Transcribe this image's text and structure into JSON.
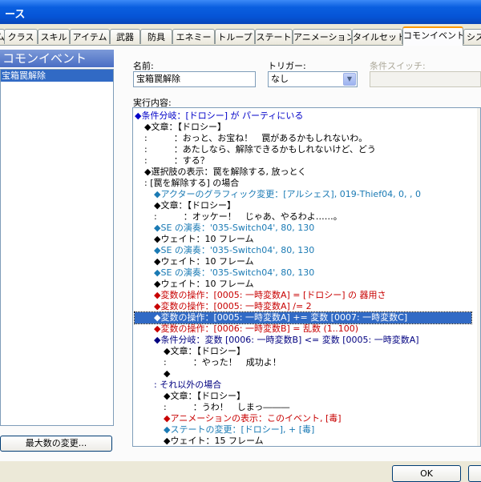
{
  "window": {
    "title": "ース"
  },
  "tabs": [
    {
      "label": "ム"
    },
    {
      "label": "クラス"
    },
    {
      "label": "スキル"
    },
    {
      "label": "アイテム"
    },
    {
      "label": "武器"
    },
    {
      "label": "防具"
    },
    {
      "label": "エネミー"
    },
    {
      "label": "トループ"
    },
    {
      "label": "ステート"
    },
    {
      "label": "アニメーション"
    },
    {
      "label": "タイルセット"
    },
    {
      "label": "コモンイベント"
    },
    {
      "label": "シス"
    }
  ],
  "left": {
    "header": "コモンイベント",
    "items": [
      {
        "label": "宝箱罠解除"
      }
    ],
    "max_button": "最大数の変更..."
  },
  "form": {
    "name_label": "名前:",
    "name_value": "宝箱罠解除",
    "trigger_label": "トリガー:",
    "trigger_value": "なし",
    "switch_label": "条件スイッチ:",
    "contents_label": "実行内容:"
  },
  "events": [
    {
      "text": "◆条件分岐：[ドロシー] が パーティにいる",
      "color": "c-blue",
      "indent": 0
    },
    {
      "text": "◆文章：【ドロシー】",
      "color": "c-black",
      "indent": 1
    },
    {
      "text": ":　　　：おっと、お宝ね！　罠があるかもしれないわ。",
      "color": "c-black",
      "indent": 1
    },
    {
      "text": ":　　　：あたしなら、解除できるかもしれないけど、どう",
      "color": "c-black",
      "indent": 1
    },
    {
      "text": ":　　　：する？",
      "color": "c-black",
      "indent": 1
    },
    {
      "text": "◆選択肢の表示：罠を解除する, 放っとく",
      "color": "c-black",
      "indent": 1
    },
    {
      "text": ": [罠を解除する] の場合",
      "color": "c-black",
      "indent": 1
    },
    {
      "text": "◆アクターのグラフィック変更：[アルシェス], 019-Thief04, 0, , 0",
      "color": "c-teal",
      "indent": 2
    },
    {
      "text": "◆文章：【ドロシー】",
      "color": "c-black",
      "indent": 2
    },
    {
      "text": ":　　　：オッケー！　じゃあ、やるわよ……。",
      "color": "c-black",
      "indent": 2
    },
    {
      "text": "◆SE の演奏：'035-Switch04', 80, 130",
      "color": "c-teal",
      "indent": 2
    },
    {
      "text": "◆ウェイト：10 フレーム",
      "color": "c-black",
      "indent": 2
    },
    {
      "text": "◆SE の演奏：'035-Switch04', 80, 130",
      "color": "c-teal",
      "indent": 2
    },
    {
      "text": "◆ウェイト：10 フレーム",
      "color": "c-black",
      "indent": 2
    },
    {
      "text": "◆SE の演奏：'035-Switch04', 80, 130",
      "color": "c-teal",
      "indent": 2
    },
    {
      "text": "◆ウェイト：10 フレーム",
      "color": "c-black",
      "indent": 2
    },
    {
      "text": "◆変数の操作：[0005: 一時変数A] = [ドロシー] の 器用さ",
      "color": "c-red",
      "indent": 2
    },
    {
      "text": "◆変数の操作：[0005: 一時変数A] /= 2",
      "color": "c-red",
      "indent": 2
    },
    {
      "text": "◆変数の操作：[0005: 一時変数A] += 変数 [0007: 一時変数C]",
      "color": "c-red",
      "indent": 2,
      "selected": true
    },
    {
      "text": "◆変数の操作：[0006: 一時変数B] = 乱数 (1..100)",
      "color": "c-red",
      "indent": 2
    },
    {
      "text": "◆条件分岐：変数 [0006: 一時変数B] <= 変数 [0005: 一時変数A]",
      "color": "c-navy",
      "indent": 2
    },
    {
      "text": "◆文章：【ドロシー】",
      "color": "c-black",
      "indent": 3
    },
    {
      "text": ":　　　：やった！　成功よ！",
      "color": "c-black",
      "indent": 3
    },
    {
      "text": "◆",
      "color": "c-black",
      "indent": 3
    },
    {
      "text": ": それ以外の場合",
      "color": "c-navy",
      "indent": 2
    },
    {
      "text": "◆文章：【ドロシー】",
      "color": "c-black",
      "indent": 3
    },
    {
      "text": ":　　　：うわ！　しまっ―――",
      "color": "c-black",
      "indent": 3
    },
    {
      "text": "◆アニメーションの表示：このイベント, [毒]",
      "color": "c-red",
      "indent": 3
    },
    {
      "text": "◆ステートの変更：[ドロシー], + [毒]",
      "color": "c-teal",
      "indent": 3
    },
    {
      "text": "◆ウェイト：15 フレーム",
      "color": "c-black",
      "indent": 3
    }
  ],
  "buttons": {
    "ok": "OK"
  }
}
